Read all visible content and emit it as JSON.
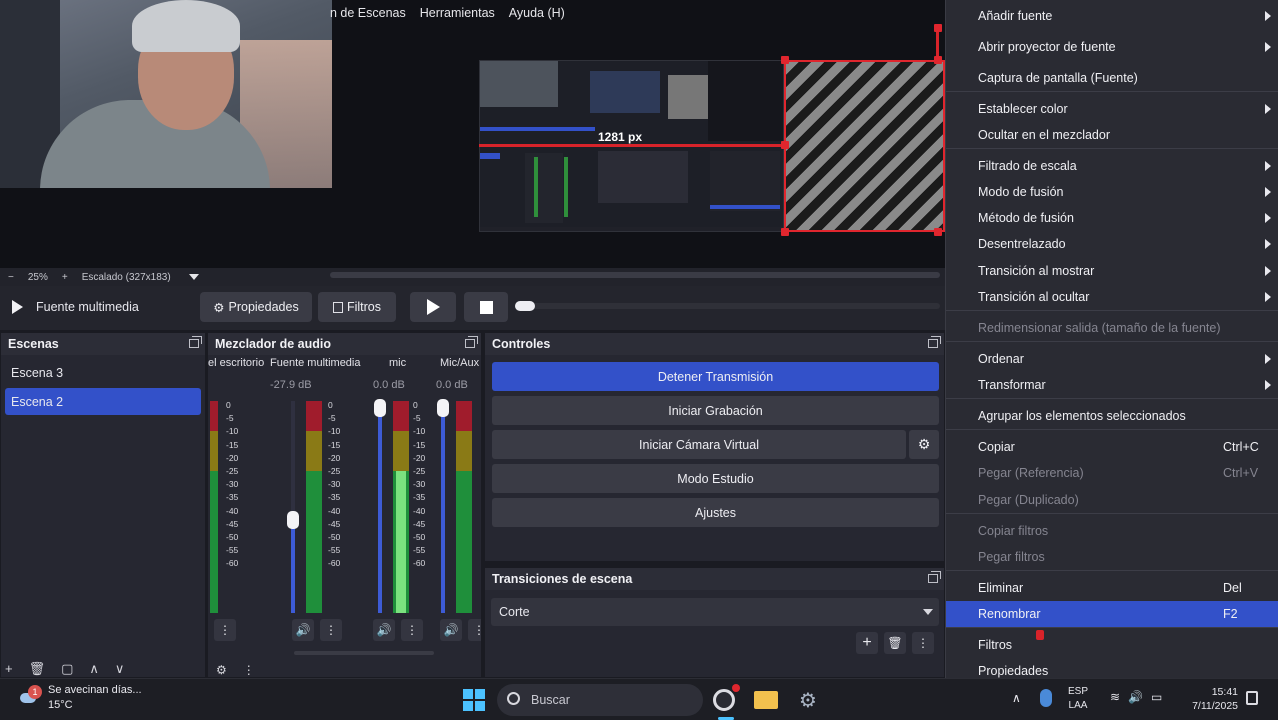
{
  "menubar": {
    "items": [
      "n de Escenas",
      "Herramientas",
      "Ayuda (H)"
    ]
  },
  "preview": {
    "size_label": "1281 px",
    "zoom": "25%",
    "scaling": "Escalado (327x183)",
    "zoom_minus": "−",
    "zoom_plus": "+"
  },
  "media": {
    "source_name": "Fuente multimedia",
    "properties_label": "Propiedades",
    "filters_label": "Filtros",
    "play_icon": "play-icon",
    "stop_icon": "stop-icon",
    "progress": 0.0
  },
  "scenes": {
    "title": "Escenas",
    "items": [
      "Escena 3",
      "Escena 2"
    ],
    "selected_index": 1,
    "footer": [
      "+",
      "🗑",
      "▢",
      "∧",
      "∨"
    ]
  },
  "mixer": {
    "title": "Mezclador de audio",
    "channels": [
      {
        "name": "el escritorio",
        "db": ""
      },
      {
        "name": "Fuente multimedia",
        "db": "-27.9 dB",
        "fader": 0.44
      },
      {
        "name": "mic",
        "db": "0.0 dB",
        "fader": 1.0
      },
      {
        "name": "Mic/Aux",
        "db": "0.0 dB",
        "fader": 1.0
      }
    ],
    "scale": [
      "0",
      "-5",
      "-10",
      "-15",
      "-20",
      "-25",
      "-30",
      "-35",
      "-40",
      "-45",
      "-50",
      "-55",
      "-60"
    ]
  },
  "controls": {
    "title": "Controles",
    "buttons": [
      "Detener Transmisión",
      "Iniciar Grabación",
      "Iniciar Cámara Virtual",
      "Modo Estudio",
      "Ajustes"
    ]
  },
  "transitions": {
    "title": "Transiciones de escena",
    "selected": "Corte"
  },
  "context_menu": {
    "items": [
      {
        "label": "Añadir fuente",
        "submenu": true
      },
      {
        "label": "Abrir proyector de fuente",
        "submenu": true
      },
      {
        "label": "Captura de pantalla (Fuente)"
      },
      {
        "label": "Establecer color",
        "submenu": true
      },
      {
        "label": "Ocultar en el mezclador"
      },
      {
        "label": "Filtrado de escala",
        "submenu": true
      },
      {
        "label": "Modo de fusión",
        "submenu": true
      },
      {
        "label": "Método de fusión",
        "submenu": true
      },
      {
        "label": "Desentrelazado",
        "submenu": true
      },
      {
        "label": "Transición al mostrar",
        "submenu": true
      },
      {
        "label": "Transición al ocultar",
        "submenu": true
      },
      {
        "label": "Redimensionar salida (tamaño de la fuente)",
        "disabled": true
      },
      {
        "label": "Ordenar",
        "submenu": true
      },
      {
        "label": "Transformar",
        "submenu": true
      },
      {
        "label": "Agrupar los elementos seleccionados"
      },
      {
        "label": "Copiar",
        "shortcut": "Ctrl+C"
      },
      {
        "label": "Pegar (Referencia)",
        "shortcut": "Ctrl+V",
        "disabled": true
      },
      {
        "label": "Pegar (Duplicado)",
        "disabled": true
      },
      {
        "label": "Copiar filtros",
        "disabled": true
      },
      {
        "label": "Pegar filtros",
        "disabled": true
      },
      {
        "label": "Eliminar",
        "shortcut": "Del"
      },
      {
        "label": "Renombrar",
        "shortcut": "F2",
        "highlight": true
      },
      {
        "label": "Filtros"
      },
      {
        "label": "Propiedades"
      }
    ]
  },
  "taskbar": {
    "weather_text": "Se avecinan días...",
    "weather_temp": "15°C",
    "weather_badge": "1",
    "search_placeholder": "Buscar",
    "lang_top": "ESP",
    "lang_bottom": "LAA",
    "time": "15:41",
    "date": "7/11/2025"
  },
  "colors": {
    "accent": "#3351c9",
    "selection_red": "#e0262e"
  }
}
